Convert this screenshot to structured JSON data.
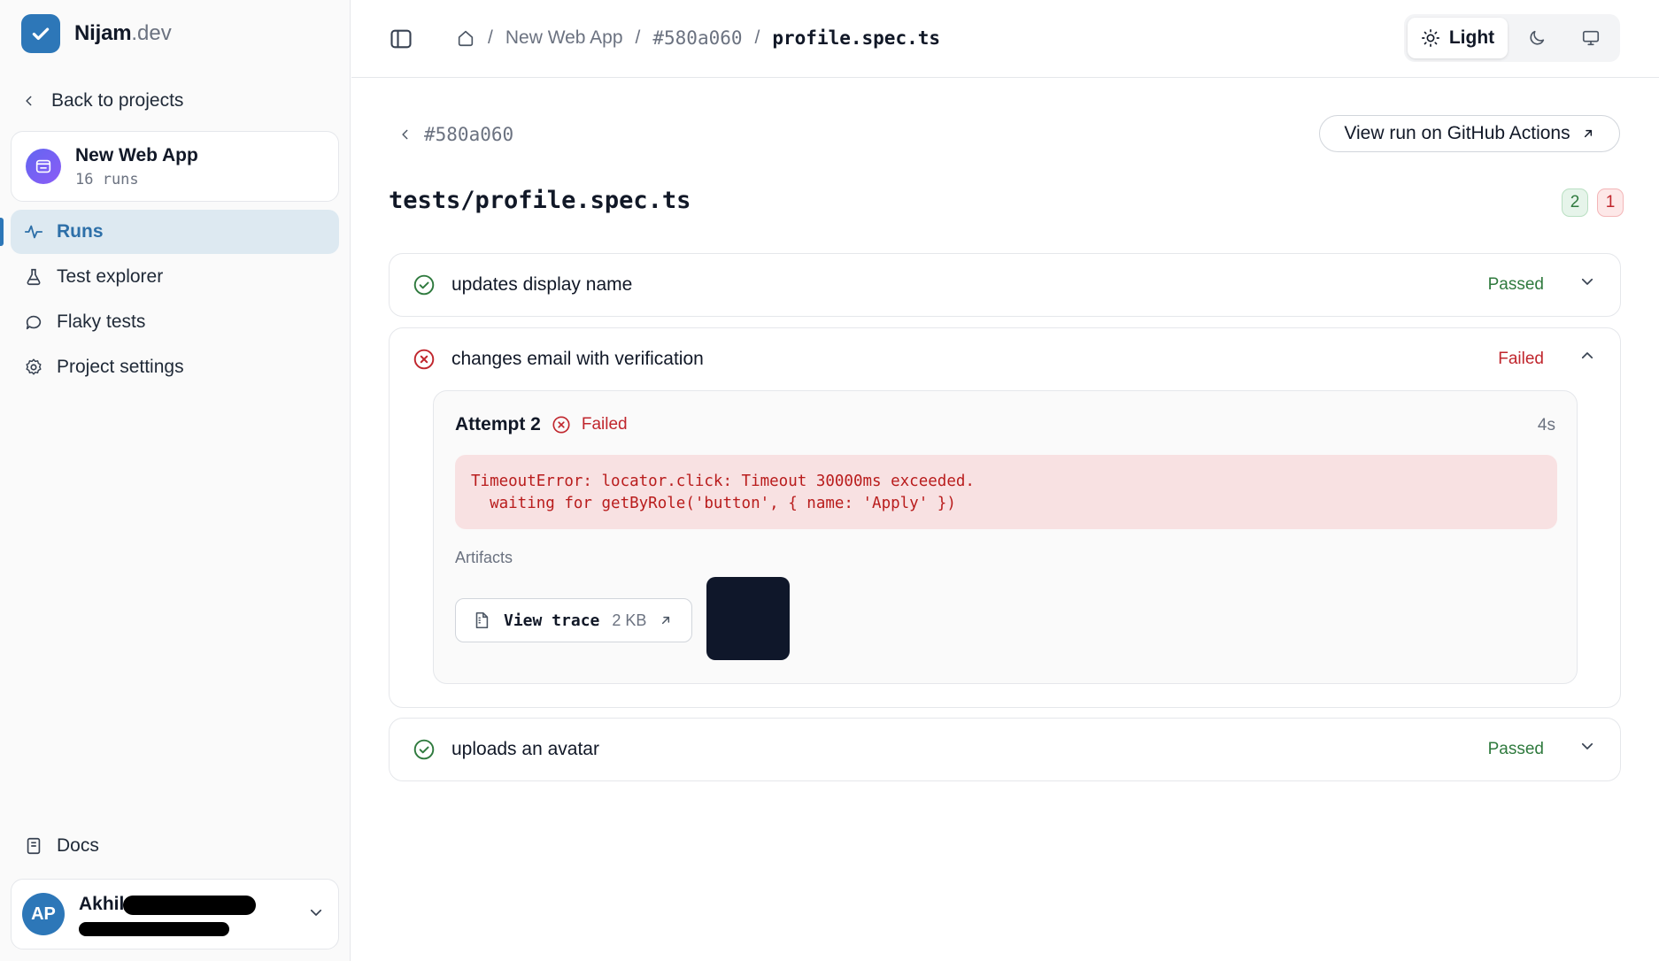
{
  "brand": {
    "name": "Nijam",
    "tld": ".dev"
  },
  "sidebar": {
    "back_label": "Back to projects",
    "project": {
      "name": "New Web App",
      "runs": "16 runs"
    },
    "items": [
      {
        "label": "Runs",
        "icon": "activity-icon",
        "active": true
      },
      {
        "label": "Test explorer",
        "icon": "flask-icon"
      },
      {
        "label": "Flaky tests",
        "icon": "chat-bubble-icon"
      },
      {
        "label": "Project settings",
        "icon": "gear-icon"
      }
    ],
    "docs_label": "Docs",
    "user": {
      "initials": "AP",
      "name": "Akhil"
    }
  },
  "header": {
    "breadcrumbs": [
      "New Web App",
      "#580a060",
      "profile.spec.ts"
    ],
    "separator": "/",
    "theme": {
      "light_label": "Light",
      "active": "light"
    }
  },
  "main": {
    "back_run": "#580a060",
    "github_button": "View run on GitHub Actions",
    "file_title": "tests/profile.spec.ts",
    "counts": {
      "passed": "2",
      "failed": "1"
    },
    "tests": [
      {
        "name": "updates display name",
        "status": "Passed"
      },
      {
        "name": "changes email with verification",
        "status": "Failed",
        "expanded": true,
        "attempt": {
          "title": "Attempt 2",
          "status": "Failed",
          "duration": "4s",
          "error": "TimeoutError: locator.click: Timeout 30000ms exceeded.\n  waiting for getByRole('button', { name: 'Apply' })",
          "artifacts_label": "Artifacts",
          "trace_label": "View trace",
          "trace_size": "2 KB"
        }
      },
      {
        "name": "uploads an avatar",
        "status": "Passed"
      }
    ]
  },
  "colors": {
    "accent": "#2d77b8",
    "pass": "#2f7a3e",
    "fail": "#c0262d",
    "error_bg": "#f8e1e2"
  }
}
